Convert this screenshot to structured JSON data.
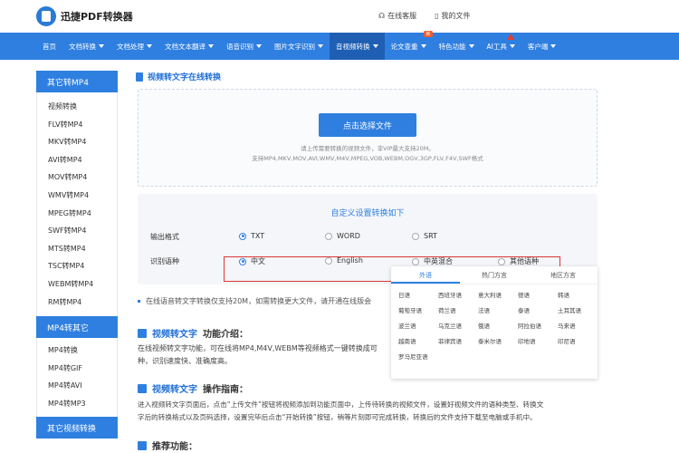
{
  "header": {
    "brand": "迅捷PDF转换器",
    "service": "在线客服",
    "files": "我的文件"
  },
  "nav": [
    {
      "label": "首页",
      "caret": false
    },
    {
      "label": "文档转换",
      "caret": true
    },
    {
      "label": "文档处理",
      "caret": true
    },
    {
      "label": "文档文本翻译",
      "caret": true
    },
    {
      "label": "语音识别",
      "caret": true
    },
    {
      "label": "图片文字识别",
      "caret": true
    },
    {
      "label": "音视频转换",
      "caret": true,
      "active": true
    },
    {
      "label": "论文查重",
      "caret": true,
      "badge": "新"
    },
    {
      "label": "特色功能",
      "caret": true
    },
    {
      "label": "AI工具",
      "caret": true,
      "warn": true
    },
    {
      "label": "客户端",
      "caret": true
    }
  ],
  "sidebar": {
    "sec1_title": "其它转MP4",
    "sec1_items": [
      "视频转换",
      "FLV转MP4",
      "MKV转MP4",
      "AVI转MP4",
      "MOV转MP4",
      "WMV转MP4",
      "MPEG转MP4",
      "SWF转MP4",
      "MTS转MP4",
      "TSC转MP4",
      "WEBM转MP4",
      "RM转MP4"
    ],
    "sec2_title": "MP4转其它",
    "sec2_items": [
      "MP4转换",
      "MP4转GIF",
      "MP4转AVI",
      "MP4转MP3"
    ],
    "sec3_title": "其它视频转换"
  },
  "main": {
    "title": "视频转文字在线转换",
    "upload_button": "点击选择文件",
    "hint1": "请上传需要转换的视频文件，非VIP最大支持20M。",
    "hint2": "支持MP4,MKV,MOV,AVI,WMV,M4V,MPEG,VOB,WEBM,OGV,3GP,FLV,F4V,SWF格式",
    "settings_title": "自定义设置转换如下",
    "output_label": "输出格式",
    "output_options": [
      "TXT",
      "WORD",
      "SRT"
    ],
    "lang_label": "识别语种",
    "lang_options": [
      "中文",
      "English",
      "中英混合",
      "其他语种"
    ],
    "note": "在线语音转文字转换仅支持20M，如需转换更大文件，请开通在线版会",
    "h_intro_blue": "视频转文字",
    "h_intro_rest": "功能介绍：",
    "intro_l1": "在线视频转文字功能，可在线将MP4,M4V,WEBM等视频格式一键转换成可",
    "intro_l2": "种，识别速度快、准确度高。",
    "h_guide_blue": "视频转文字",
    "h_guide_rest": "操作指南：",
    "guide_l1": "进入视频转文字页面后，点击“上传文件”按钮将视频添加到功能页面中，上传待转换的视频文件，设置好视频文件的语种类型、转换文",
    "guide_l2": "字后的转换格式以及页码选择，设置完毕后点击“开始转换”按钮，稍等片刻即可完成转换，转换后的文件支持下载至电脑或手机中。",
    "h_rec": "推荐功能："
  },
  "lang_panel": {
    "tabs": [
      "外语",
      "热门方言",
      "地区方言"
    ],
    "items": [
      "日语",
      "西班牙语",
      "意大利语",
      "德语",
      "韩语",
      "葡萄牙语",
      "荷兰语",
      "法语",
      "泰语",
      "土耳其语",
      "波兰语",
      "乌克兰语",
      "俄语",
      "阿拉伯语",
      "马来语",
      "越南语",
      "菲律宾语",
      "泰米尔语",
      "印地语",
      "印尼语",
      "罗马尼亚语"
    ]
  }
}
